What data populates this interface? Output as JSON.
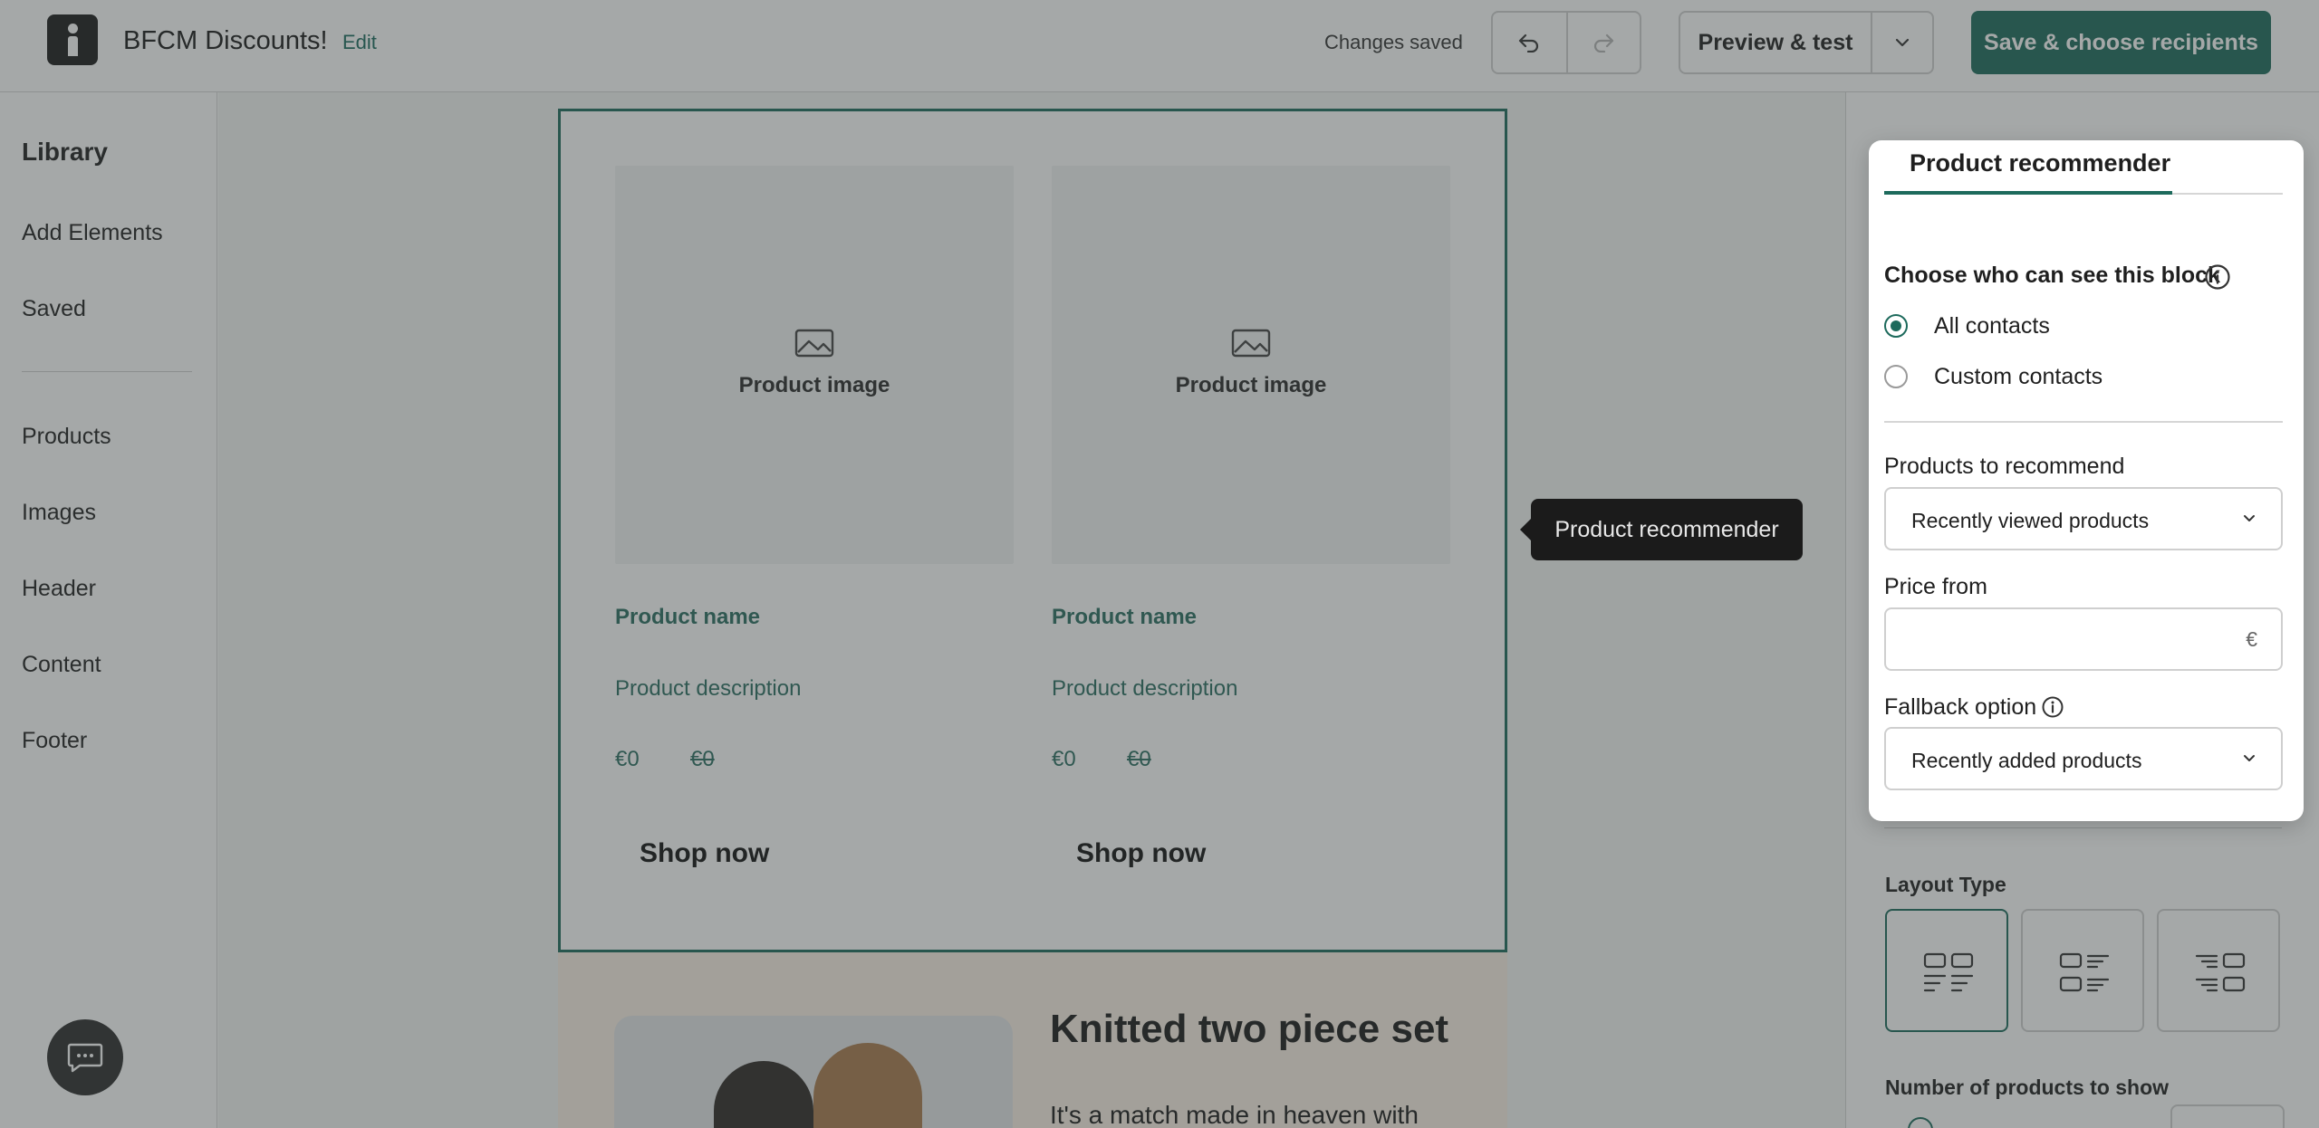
{
  "header": {
    "document_title": "BFCM Discounts!",
    "edit_label": "Edit",
    "save_status": "Changes saved",
    "preview_label": "Preview & test",
    "save_label": "Save & choose recipients"
  },
  "sidebar": {
    "title": "Library",
    "top_items": [
      "Add Elements",
      "Saved"
    ],
    "block_items": [
      "Products",
      "Images",
      "Header",
      "Content",
      "Footer"
    ]
  },
  "canvas": {
    "products": [
      {
        "image_label": "Product image",
        "name": "Product name",
        "description": "Product description",
        "price": "€0",
        "old_price": "€0",
        "cta": "Shop now"
      },
      {
        "image_label": "Product image",
        "name": "Product name",
        "description": "Product description",
        "price": "€0",
        "old_price": "€0",
        "cta": "Shop now"
      }
    ],
    "feature": {
      "title": "Knitted two piece set",
      "body": "It's a match made in heaven with"
    }
  },
  "tooltip": {
    "text": "Product recommender"
  },
  "popup": {
    "tab": "Product recommender",
    "visibility_heading": "Choose who can see this block",
    "visibility_options": [
      {
        "label": "All contacts",
        "checked": true
      },
      {
        "label": "Custom contacts",
        "checked": false
      }
    ],
    "products_label": "Products to recommend",
    "products_value": "Recently viewed products",
    "price_label": "Price from",
    "price_value": "",
    "price_unit": "€",
    "fallback_label": "Fallback option",
    "fallback_value": "Recently added products"
  },
  "panel": {
    "layout_label": "Layout Type",
    "count_label": "Number of products to show"
  },
  "colors": {
    "brand": "#1d6a5c",
    "tooltip_bg": "#1b1b1b",
    "overlay": "rgba(55,62,62,0.45)"
  },
  "icons": [
    "app-logo-icon",
    "undo-icon",
    "redo-icon",
    "chevron-down-icon",
    "image-placeholder-icon",
    "info-icon",
    "layout-grid-icon",
    "layout-list-left-icon",
    "layout-list-right-icon",
    "chat-icon"
  ]
}
